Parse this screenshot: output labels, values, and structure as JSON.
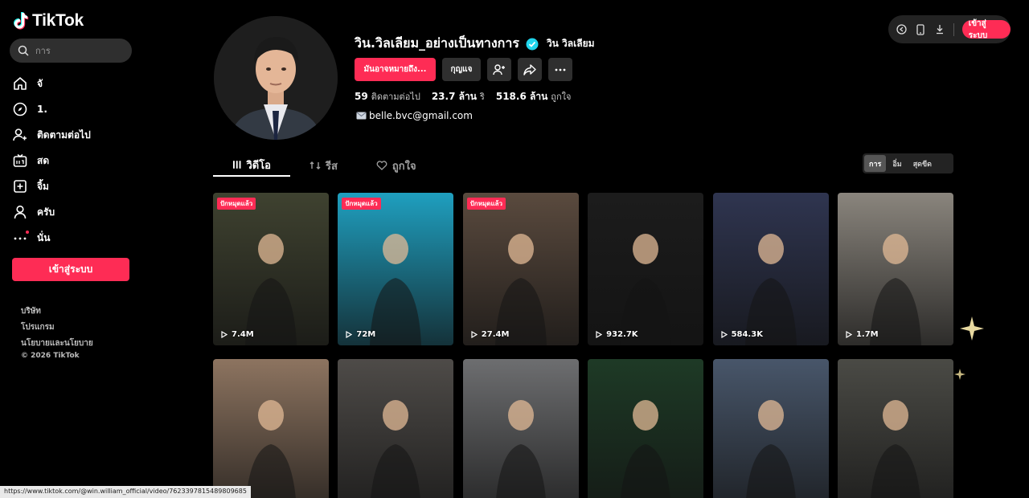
{
  "brand": {
    "name": "TikTok"
  },
  "search": {
    "placeholder": "การ"
  },
  "sidebar": {
    "items": [
      {
        "label": "จั",
        "icon": "home-icon"
      },
      {
        "label": "1.",
        "icon": "compass-icon"
      },
      {
        "label": "ติดตามต่อไป",
        "icon": "following-icon"
      },
      {
        "label": "สด",
        "icon": "live-icon"
      },
      {
        "label": "จิ้ม",
        "icon": "upload-icon"
      },
      {
        "label": "ครับ",
        "icon": "profile-icon"
      },
      {
        "label": "นั่น",
        "icon": "more-icon"
      }
    ],
    "login_label": "เข้าสู่ระบบ",
    "footer": [
      "บริษัท",
      "โปรแกรม",
      "นโยบายและนโยบาย"
    ],
    "copyright": "© 2026 TikTok"
  },
  "top": {
    "login_label": "เข้าสู่ระบบ"
  },
  "profile": {
    "username": "วิน.วิลเลียม_อย่างเป็นทางการ",
    "nickname": "วิน วิลเลียม",
    "primary_button": "มันอาจหมายถึง...",
    "key_button": "กุญแจ",
    "stats": [
      {
        "value": "59",
        "label": "ติดตามต่อไป"
      },
      {
        "value": "23.7 ล้าน",
        "label": "ริ"
      },
      {
        "value": "518.6 ล้าน",
        "label": "ถูกใจ"
      }
    ],
    "email": "belle.bvc@gmail.com"
  },
  "tabs": [
    {
      "label": "วิดีโอ",
      "icon": "grid-icon"
    },
    {
      "label": "รีส",
      "icon": "repost-icon"
    },
    {
      "label": "ถูกใจ",
      "icon": "heart-icon"
    }
  ],
  "sort": [
    "การ",
    "อิ่ม",
    "สุดขีด"
  ],
  "videos": [
    {
      "views": "7.4M",
      "pinned": "ปักหมุดแล้ว",
      "bg": "#3f4230"
    },
    {
      "views": "72M",
      "pinned": "ปักหมุดแล้ว",
      "bg": "#1f9fbf"
    },
    {
      "views": "27.4M",
      "pinned": "ปักหมุดแล้ว",
      "bg": "#5a4a3e"
    },
    {
      "views": "932.7K",
      "pinned": "",
      "bg": "#1c1c1c"
    },
    {
      "views": "584.3K",
      "pinned": "",
      "bg": "#2f3550"
    },
    {
      "views": "1.7M",
      "pinned": "",
      "bg": "#8a857d"
    },
    {
      "views": "",
      "pinned": "",
      "bg": "#8d7460"
    },
    {
      "views": "",
      "pinned": "",
      "bg": "#4e4b48"
    },
    {
      "views": "",
      "pinned": "",
      "bg": "#6d6e70"
    },
    {
      "views": "",
      "pinned": "",
      "bg": "#1e3a26"
    },
    {
      "views": "",
      "pinned": "",
      "bg": "#48566a"
    },
    {
      "views": "",
      "pinned": "",
      "bg": "#4a4a45"
    }
  ],
  "status_url": "https://www.tiktok.com/@win.william_official/video/7623397815489809685"
}
